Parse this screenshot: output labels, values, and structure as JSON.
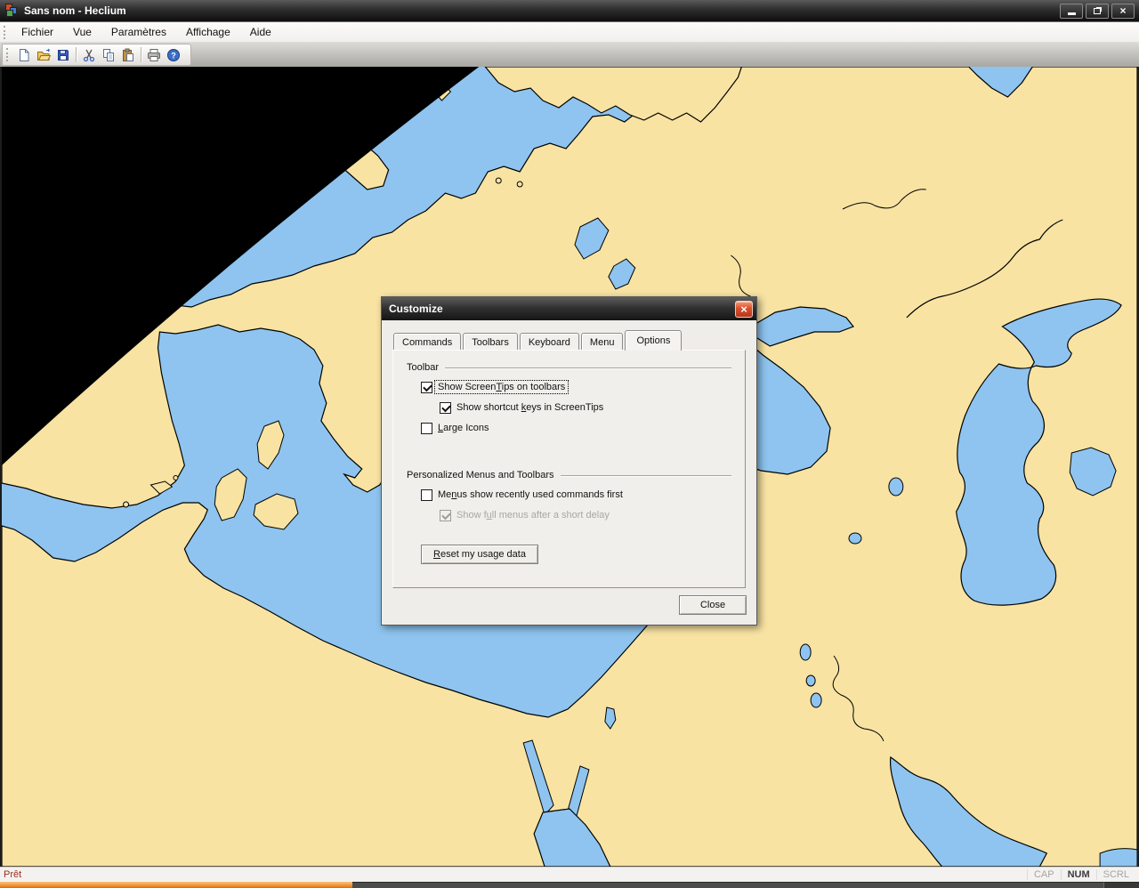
{
  "window": {
    "title": "Sans nom - Heclium",
    "controls": {
      "minimize": "minimize",
      "restore": "restore",
      "close": "×"
    }
  },
  "menu_bar": {
    "items": [
      "Fichier",
      "Vue",
      "Paramètres",
      "Affichage",
      "Aide"
    ]
  },
  "toolbar": {
    "icons": [
      "new-document-icon",
      "open-folder-icon",
      "save-icon",
      "cut-icon",
      "copy-icon",
      "paste-icon",
      "print-icon",
      "help-icon"
    ]
  },
  "map": {
    "colors": {
      "water": "#8EC4EF",
      "land": "#F8E3A3",
      "coast": "#000000",
      "space": "#000000"
    }
  },
  "dialog": {
    "title": "Customize",
    "close_glyph": "×",
    "tabs": [
      {
        "label": "Commands",
        "active": false
      },
      {
        "label": "Toolbars",
        "active": false
      },
      {
        "label": "Keyboard",
        "active": false
      },
      {
        "label": "Menu",
        "active": false
      },
      {
        "label": "Options",
        "active": true
      }
    ],
    "groups": [
      {
        "label": "Toolbar",
        "items": [
          {
            "text": "Show ScreenTips on toolbars",
            "accel_index": 11,
            "checked": true,
            "disabled": false,
            "indent": false,
            "focused": true
          },
          {
            "text": "Show shortcut keys in ScreenTips",
            "accel_index": 14,
            "checked": true,
            "disabled": false,
            "indent": true,
            "focused": false
          },
          {
            "text": "Large Icons",
            "accel_index": 0,
            "checked": false,
            "disabled": false,
            "indent": false,
            "focused": false
          }
        ]
      },
      {
        "label": "Personalized Menus and Toolbars",
        "items": [
          {
            "text": "Menus show recently used commands first",
            "accel_index": 2,
            "checked": false,
            "disabled": false,
            "indent": false,
            "focused": false
          },
          {
            "text": "Show full menus after a short delay",
            "accel_index": 6,
            "checked": true,
            "disabled": true,
            "indent": true,
            "focused": false
          }
        ]
      }
    ],
    "reset_button": {
      "text": "Reset my usage data",
      "accel_index": 0
    },
    "close_button": {
      "text": "Close"
    }
  },
  "status_bar": {
    "left": "Prêt",
    "keys": [
      {
        "label": "CAP",
        "active": false
      },
      {
        "label": "NUM",
        "active": true
      },
      {
        "label": "SCRL",
        "active": false
      }
    ]
  }
}
